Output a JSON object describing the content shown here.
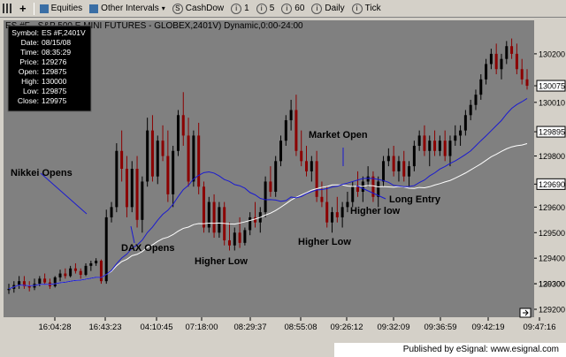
{
  "toolbar": {
    "items": [
      {
        "name": "grid-view-icon",
        "label": ""
      },
      {
        "name": "add-icon",
        "label": ""
      },
      {
        "name": "equities-button",
        "label": "Equities"
      },
      {
        "name": "other-intervals-button",
        "label": "Other Intervals"
      },
      {
        "name": "cashdow-button",
        "label": "CashDow"
      },
      {
        "name": "interval-1-button",
        "label": "1"
      },
      {
        "name": "interval-5-button",
        "label": "5"
      },
      {
        "name": "interval-60-button",
        "label": "60"
      },
      {
        "name": "daily-button",
        "label": "Daily"
      },
      {
        "name": "tick-button",
        "label": "Tick"
      }
    ]
  },
  "chart_title": "ES #F - S&P 500 E MINI FUTURES - GLOBEX,2401V) Dynamic,0:00-24:00",
  "info_box": {
    "rows": [
      {
        "label": "Symbol:",
        "value": "ES #F,2401V"
      },
      {
        "label": "Date:",
        "value": "08/15/08"
      },
      {
        "label": "Time:",
        "value": "08:35:29"
      },
      {
        "label": "Price:",
        "value": "129276"
      },
      {
        "label": "Open:",
        "value": "129875"
      },
      {
        "label": "High:",
        "value": "130000"
      },
      {
        "label": "Low:",
        "value": "129875"
      },
      {
        "label": "Close:",
        "value": "129975"
      }
    ]
  },
  "price_labels": [
    {
      "value": "130300",
      "y": 129300,
      "highlight": false
    },
    {
      "value": "130200",
      "y": 130200,
      "highlight": false
    },
    {
      "value": "130075",
      "y": 130075,
      "highlight": true
    },
    {
      "value": "130010",
      "y": 130010,
      "highlight": false
    },
    {
      "value": "129895",
      "y": 129895,
      "highlight": true
    },
    {
      "value": "129800",
      "y": 129800,
      "highlight": false
    },
    {
      "value": "129690",
      "y": 129690,
      "highlight": true
    },
    {
      "value": "129600",
      "y": 129600,
      "highlight": false
    },
    {
      "value": "129500",
      "y": 129500,
      "highlight": false
    },
    {
      "value": "129400",
      "y": 129400,
      "highlight": false
    },
    {
      "value": "129300",
      "y": 129300,
      "highlight": false
    },
    {
      "value": "129200",
      "y": 129200,
      "highlight": false
    }
  ],
  "time_labels": [
    "16:04:28",
    "16:43:23",
    "04:10:45",
    "07:18:00",
    "08:29:37",
    "08:55:08",
    "09:26:12",
    "09:32:09",
    "09:36:59",
    "09:42:19",
    "09:47:16"
  ],
  "annotations": [
    {
      "name": "nikkei-opens-label",
      "text": "Nikkei Opens"
    },
    {
      "name": "dax-opens-label",
      "text": "DAX Opens"
    },
    {
      "name": "higher-low-label-1",
      "text": "Higher Low"
    },
    {
      "name": "higher-low-label-2",
      "text": "Higher Low"
    },
    {
      "name": "market-open-label",
      "text": "Market Open"
    },
    {
      "name": "long-entry-label",
      "text": "Long Entry"
    },
    {
      "name": "higher-low-label-3",
      "text": "Higher low"
    }
  ],
  "footer": {
    "text": "Published by eSignal: www.esignal.com"
  },
  "colors": {
    "plot_bg": "#808080",
    "up_bar": "#000000",
    "down_bar": "#8b0000",
    "ma_fast": "#0000cc",
    "ma_slow": "#ffffff",
    "info_bg": "#000000",
    "info_text": "#ffffff"
  },
  "chart_data": {
    "type": "candlestick",
    "title": "ES #F - S&P 500 E MINI FUTURES - GLOBEX,2401V) Dynamic,0:00-24:00",
    "ylim": [
      129200,
      130300
    ],
    "candles": [
      [
        129275,
        129300,
        129260,
        129280
      ],
      [
        129280,
        129310,
        129265,
        129295
      ],
      [
        129295,
        129330,
        129280,
        129310
      ],
      [
        129310,
        129330,
        129280,
        129290
      ],
      [
        129290,
        129310,
        129270,
        129285
      ],
      [
        129285,
        129320,
        129275,
        129300
      ],
      [
        129300,
        129330,
        129290,
        129320
      ],
      [
        129320,
        129340,
        129295,
        129305
      ],
      [
        129305,
        129320,
        129280,
        129290
      ],
      [
        129290,
        129330,
        129285,
        129325
      ],
      [
        129325,
        129355,
        129310,
        129340
      ],
      [
        129340,
        129360,
        129320,
        129330
      ],
      [
        129330,
        129370,
        129325,
        129360
      ],
      [
        129360,
        129380,
        129340,
        129350
      ],
      [
        129350,
        129360,
        129320,
        129335
      ],
      [
        129335,
        129380,
        129330,
        129370
      ],
      [
        129370,
        129390,
        129350,
        129380
      ],
      [
        129380,
        129400,
        129370,
        129390
      ],
      [
        129390,
        129395,
        129300,
        129310
      ],
      [
        129310,
        129590,
        129300,
        129560
      ],
      [
        129560,
        129620,
        129540,
        129600
      ],
      [
        129600,
        129850,
        129580,
        129820
      ],
      [
        129820,
        129900,
        129700,
        129750
      ],
      [
        129750,
        129800,
        129560,
        129600
      ],
      [
        129600,
        129780,
        129580,
        129750
      ],
      [
        129750,
        129800,
        129520,
        129550
      ],
      [
        129550,
        129720,
        129500,
        129700
      ],
      [
        129700,
        129950,
        129680,
        129900
      ],
      [
        129900,
        129960,
        129700,
        129720
      ],
      [
        129720,
        129880,
        129690,
        129860
      ],
      [
        129860,
        129920,
        129780,
        129800
      ],
      [
        129800,
        129900,
        129620,
        129650
      ],
      [
        129650,
        129840,
        129600,
        129820
      ],
      [
        129820,
        129980,
        129800,
        129960
      ],
      [
        129960,
        130050,
        129840,
        129880
      ],
      [
        129880,
        129950,
        129680,
        129700
      ],
      [
        129700,
        129900,
        129680,
        129880
      ],
      [
        129880,
        129930,
        129650,
        129680
      ],
      [
        129680,
        129700,
        129500,
        129520
      ],
      [
        129520,
        129640,
        129500,
        129620
      ],
      [
        129620,
        129650,
        129480,
        129500
      ],
      [
        129500,
        129620,
        129480,
        129600
      ],
      [
        129600,
        129620,
        129450,
        129470
      ],
      [
        129470,
        129540,
        129430,
        129450
      ],
      [
        129450,
        129520,
        129430,
        129500
      ],
      [
        129500,
        129560,
        129440,
        129460
      ],
      [
        129460,
        129520,
        129450,
        129510
      ],
      [
        129510,
        129580,
        129490,
        129560
      ],
      [
        129560,
        129620,
        129520,
        129540
      ],
      [
        129540,
        129600,
        129500,
        129580
      ],
      [
        129580,
        129720,
        129560,
        129700
      ],
      [
        129700,
        129760,
        129640,
        129660
      ],
      [
        129660,
        129800,
        129640,
        129780
      ],
      [
        129780,
        129880,
        129760,
        129860
      ],
      [
        129860,
        129960,
        129840,
        129940
      ],
      [
        129940,
        130020,
        129900,
        129980
      ],
      [
        129980,
        130040,
        129800,
        129820
      ],
      [
        129820,
        129900,
        129760,
        129780
      ],
      [
        129780,
        129840,
        129720,
        129740
      ],
      [
        129740,
        129800,
        129700,
        129780
      ],
      [
        129780,
        129820,
        129620,
        129640
      ],
      [
        129640,
        129700,
        129600,
        129620
      ],
      [
        129620,
        129680,
        129520,
        129540
      ],
      [
        129540,
        129600,
        129500,
        129580
      ],
      [
        129580,
        129640,
        129540,
        129560
      ],
      [
        129560,
        129620,
        129520,
        129600
      ],
      [
        129600,
        129660,
        129580,
        129620
      ],
      [
        129620,
        129700,
        129600,
        129680
      ],
      [
        129680,
        129740,
        129640,
        129660
      ],
      [
        129660,
        129720,
        129620,
        129700
      ],
      [
        129700,
        129760,
        129680,
        129720
      ],
      [
        129720,
        129740,
        129620,
        129640
      ],
      [
        129640,
        129720,
        129600,
        129700
      ],
      [
        129700,
        129800,
        129680,
        129780
      ],
      [
        129780,
        129830,
        129760,
        129800
      ],
      [
        129800,
        129840,
        129720,
        129740
      ],
      [
        129740,
        129800,
        129700,
        129780
      ],
      [
        129780,
        129820,
        129700,
        129720
      ],
      [
        129720,
        129780,
        129680,
        129760
      ],
      [
        129760,
        129860,
        129740,
        129840
      ],
      [
        129840,
        129900,
        129820,
        129880
      ],
      [
        129880,
        129920,
        129800,
        129820
      ],
      [
        129820,
        129880,
        129760,
        129860
      ],
      [
        129860,
        129900,
        129800,
        129820
      ],
      [
        129820,
        129880,
        129800,
        129860
      ],
      [
        129860,
        129900,
        129780,
        129800
      ],
      [
        129800,
        129880,
        129760,
        129860
      ],
      [
        129860,
        129920,
        129840,
        129880
      ],
      [
        129880,
        129920,
        129840,
        129900
      ],
      [
        129900,
        129980,
        129880,
        129960
      ],
      [
        129960,
        130020,
        129940,
        130000
      ],
      [
        130000,
        130060,
        129980,
        130040
      ],
      [
        130040,
        130120,
        130020,
        130100
      ],
      [
        130100,
        130180,
        130080,
        130160
      ],
      [
        130160,
        130220,
        130140,
        130200
      ],
      [
        130200,
        130240,
        130120,
        130140
      ],
      [
        130140,
        130200,
        130100,
        130180
      ],
      [
        130180,
        130250,
        130160,
        130230
      ],
      [
        130230,
        130260,
        130180,
        130200
      ],
      [
        130200,
        130240,
        130120,
        130140
      ],
      [
        130140,
        130180,
        130080,
        130100
      ],
      [
        130100,
        130140,
        130060,
        130075
      ]
    ]
  }
}
